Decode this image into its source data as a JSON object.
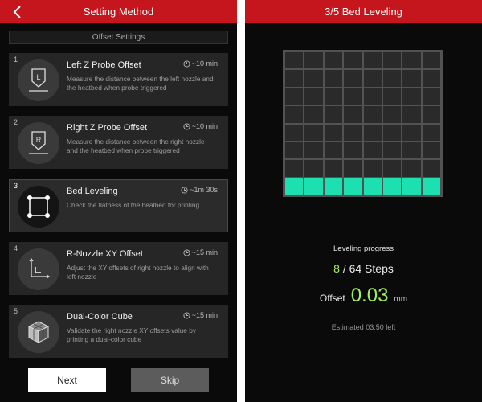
{
  "left_screen": {
    "header": {
      "title": "Setting Method"
    },
    "section_title": "Offset Settings",
    "items": [
      {
        "number": "1",
        "title": "Left Z Probe Offset",
        "time": "~10 min",
        "description": "Measure the distance between the left nozzle and the heatbed when probe triggered",
        "icon": "left-nozzle-probe-icon",
        "icon_letter": "L"
      },
      {
        "number": "2",
        "title": "Right Z Probe Offset",
        "time": "~10 min",
        "description": "Measure the distance between the right nozzle and the heatbed when probe triggered",
        "icon": "right-nozzle-probe-icon",
        "icon_letter": "R"
      },
      {
        "number": "3",
        "title": "Bed Leveling",
        "time": "~1m 30s",
        "description": "Check the flatness of the heatbed for printing",
        "icon": "bed-leveling-icon"
      },
      {
        "number": "4",
        "title": "R-Nozzle XY Offset",
        "time": "~15 min",
        "description": "Adjust the XY offsets of right nozzle to align with left nozzle",
        "icon": "xy-axis-icon"
      },
      {
        "number": "5",
        "title": "Dual-Color Cube",
        "time": "~15 min",
        "description": "Validate the right nozzle XY offsets value by printing a dual-color cube",
        "icon": "cube-icon"
      }
    ],
    "buttons": {
      "next": "Next",
      "skip": "Skip"
    }
  },
  "right_screen": {
    "header": {
      "title": "3/5 Bed Leveling"
    },
    "leveling_grid": {
      "rows": 8,
      "cols": 8,
      "completed_cells": 8,
      "fill_color": "#1de0b0",
      "empty_color": "#2a2a2a"
    },
    "progress_label": "Leveling progress",
    "steps_done": "8",
    "steps_separator": "/",
    "steps_total": "64 Steps",
    "offset_label": "Offset",
    "offset_value": "0.03",
    "offset_unit": "mm",
    "estimated": "Estimated 03:50 left"
  },
  "colors": {
    "accent": "#c4161c",
    "highlight_green": "#a4f05a",
    "teal": "#1de0b0"
  }
}
